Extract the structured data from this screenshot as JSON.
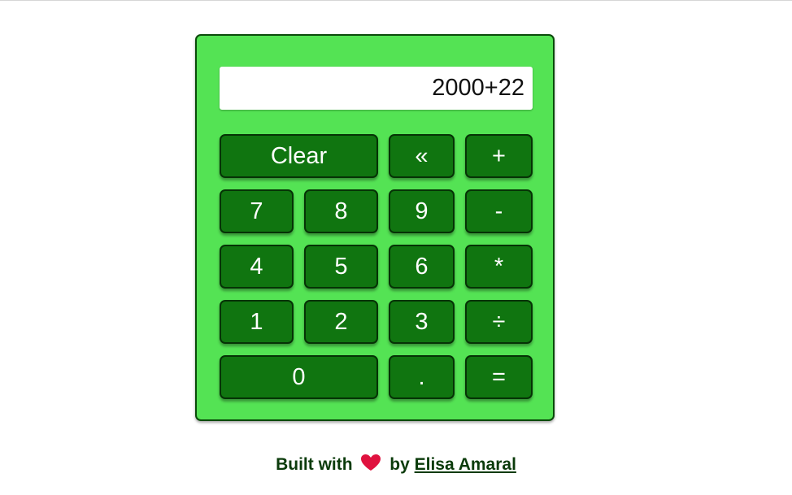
{
  "display": {
    "value": "2000+22"
  },
  "keys": {
    "clear": "Clear",
    "backspace": "«",
    "plus": "+",
    "seven": "7",
    "eight": "8",
    "nine": "9",
    "minus": "-",
    "four": "4",
    "five": "5",
    "six": "6",
    "multiply": "*",
    "one": "1",
    "two": "2",
    "three": "3",
    "divide": "÷",
    "zero": "0",
    "decimal": ".",
    "equals": "="
  },
  "footer": {
    "prefix": "Built with",
    "middle": "by",
    "author": "Elisa Amaral",
    "heart_icon": "heart-icon",
    "heart_color": "#e0123f"
  },
  "colors": {
    "calculator_body": "#54e354",
    "key_background": "#107510",
    "key_text": "#ffffff",
    "footer_text": "#0b3b0b"
  }
}
